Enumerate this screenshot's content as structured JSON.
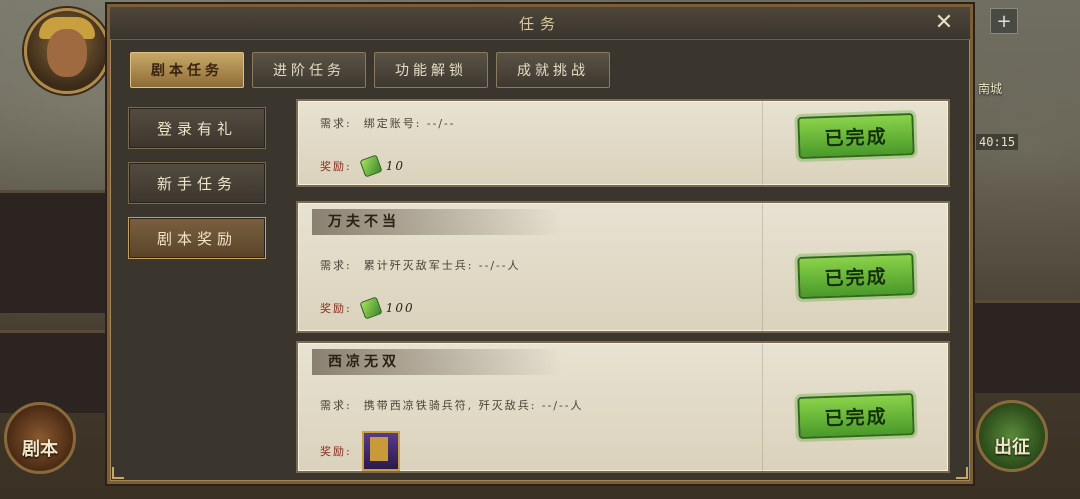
{
  "hud": {
    "plus_label": "+",
    "location_label": "南城",
    "timer": "40:15",
    "left_button_label": "剧本",
    "right_button_label": "出征"
  },
  "panel": {
    "title": "任务",
    "close_label": "✕"
  },
  "tabs": [
    {
      "label": "剧本任务",
      "active": true
    },
    {
      "label": "进阶任务",
      "active": false
    },
    {
      "label": "功能解锁",
      "active": false
    },
    {
      "label": "成就挑战",
      "active": false
    }
  ],
  "submenu": [
    {
      "label": "登录有礼",
      "active": false
    },
    {
      "label": "新手任务",
      "active": false
    },
    {
      "label": "剧本奖励",
      "active": true
    }
  ],
  "labels": {
    "requirement": "需求:",
    "reward": "奖励:"
  },
  "tasks": [
    {
      "name": "",
      "requirement": "绑定账号: --/--",
      "reward_icon": "jade-icon",
      "reward_value": "10",
      "status": "已完成"
    },
    {
      "name": "万夫不当",
      "requirement": "累计歼灭敌军士兵: --/--人",
      "reward_icon": "jade-icon",
      "reward_value": "100",
      "status": "已完成"
    },
    {
      "name": "西凉无双",
      "requirement": "携带西凉铁骑兵符, 歼灭敌兵: --/--人",
      "reward_icon": "card-icon",
      "reward_value": "",
      "status": "已完成"
    }
  ]
}
